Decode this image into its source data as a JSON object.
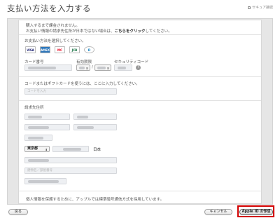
{
  "header": {
    "title": "支払い方法を入力する",
    "secure_label": "セキュア接続"
  },
  "notice": {
    "line1": "購入するまで課金されません。",
    "line2_pre": "お支払い情報の請求先住所が日本ではない場合は、",
    "line2_link": "こちらをクリック",
    "line2_post": "してください。"
  },
  "payment": {
    "select_label": "お支払い方法を選択してください。",
    "cards": [
      {
        "label": "VISA",
        "color": "#1a1f71"
      },
      {
        "label": "AMEX",
        "color": "#2e77bb"
      },
      {
        "label": "MC",
        "color": "#eb001b"
      },
      {
        "label": "JCB",
        "color": "#0b6b3a"
      },
      {
        "label": "D",
        "color": "#0079be"
      }
    ],
    "card_number_label": "カード番号",
    "expiry_label": "有効期限",
    "security_code_label": "セキュリティコード",
    "expiry_separator": "/"
  },
  "gift": {
    "label": "コードまたはギフトカードを使うには、ここに入力してください。",
    "placeholder": "コードを入力"
  },
  "billing": {
    "label": "請求先住所",
    "prefecture": "東京都",
    "country": "日本",
    "building_placeholder": "建物名／部屋番号"
  },
  "footer": {
    "privacy_note": "個人情報を保護するために、アップルでは標準暗号通信方式を採用しています。"
  },
  "buttons": {
    "back": "戻る",
    "cancel": "キャンセル",
    "create": "Apple ID の作成"
  },
  "colors": {
    "highlight": "#d20000"
  }
}
